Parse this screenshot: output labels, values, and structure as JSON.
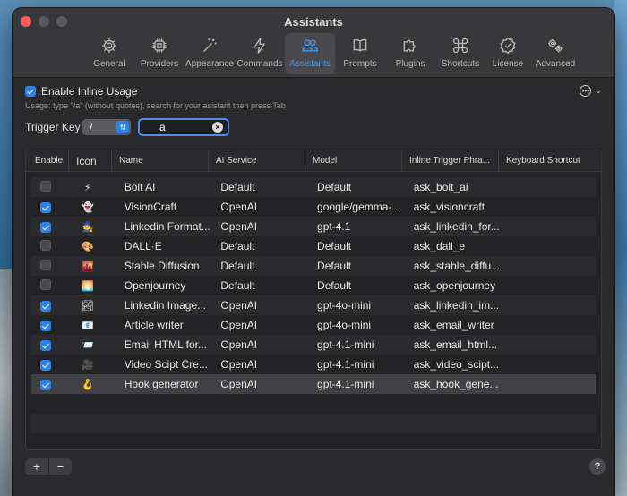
{
  "window": {
    "title": "Assistants"
  },
  "toolbar": {
    "items": [
      {
        "label": "General",
        "icon": "gear-icon"
      },
      {
        "label": "Providers",
        "icon": "chip-icon"
      },
      {
        "label": "Appearance",
        "icon": "magic-wand-icon"
      },
      {
        "label": "Commands",
        "icon": "bolt-icon"
      },
      {
        "label": "Assistants",
        "icon": "people-icon",
        "active": true
      },
      {
        "label": "Prompts",
        "icon": "book-icon"
      },
      {
        "label": "Plugins",
        "icon": "puzzle-icon"
      },
      {
        "label": "Shortcuts",
        "icon": "command-key-icon"
      },
      {
        "label": "License",
        "icon": "badge-check-icon"
      },
      {
        "label": "Advanced",
        "icon": "gears-icon"
      }
    ]
  },
  "inline": {
    "enable_label": "Enable Inline Usage",
    "enabled": true,
    "usage_hint": "Usage: type \"/a\" (without quotes), search for your asistant then press Tab"
  },
  "trigger": {
    "label": "Trigger Key",
    "selected": "/",
    "search_value": "a"
  },
  "table": {
    "columns": [
      "Enable",
      "Icon",
      "Name",
      "AI Service",
      "Model",
      "Inline Trigger Phra...",
      "Keyboard Shortcut"
    ],
    "rows": [
      {
        "enabled": false,
        "icon": "⚡",
        "name": "Bolt AI",
        "service": "Default",
        "model": "Default",
        "trigger": "ask_bolt_ai",
        "shortcut": ""
      },
      {
        "enabled": true,
        "icon": "👻",
        "name": "VisionCraft",
        "service": "OpenAI",
        "model": "google/gemma-...",
        "trigger": "ask_visioncraft",
        "shortcut": ""
      },
      {
        "enabled": true,
        "icon": "🧙",
        "name": "Linkedin Format...",
        "service": "OpenAI",
        "model": "gpt-4.1",
        "trigger": "ask_linkedin_for...",
        "shortcut": ""
      },
      {
        "enabled": false,
        "icon": "🎨",
        "name": "DALL·E",
        "service": "Default",
        "model": "Default",
        "trigger": "ask_dall_e",
        "shortcut": ""
      },
      {
        "enabled": false,
        "icon": "🌇",
        "name": "Stable Diffusion",
        "service": "Default",
        "model": "Default",
        "trigger": "ask_stable_diffu...",
        "shortcut": ""
      },
      {
        "enabled": false,
        "icon": "🌅",
        "name": "Openjourney",
        "service": "Default",
        "model": "Default",
        "trigger": "ask_openjourney",
        "shortcut": ""
      },
      {
        "enabled": true,
        "icon": "🏞",
        "name": "Linkedin Image...",
        "service": "OpenAI",
        "model": "gpt-4o-mini",
        "trigger": "ask_linkedin_im...",
        "shortcut": ""
      },
      {
        "enabled": true,
        "icon": "📧",
        "name": "Article writer",
        "service": "OpenAI",
        "model": "gpt-4o-mini",
        "trigger": "ask_email_writer",
        "shortcut": ""
      },
      {
        "enabled": true,
        "icon": "📨",
        "name": "Email HTML for...",
        "service": "OpenAI",
        "model": "gpt-4.1-mini",
        "trigger": "ask_email_html...",
        "shortcut": ""
      },
      {
        "enabled": true,
        "icon": "🎥",
        "name": "Video Scipt Cre...",
        "service": "OpenAI",
        "model": "gpt-4.1-mini",
        "trigger": "ask_video_scipt...",
        "shortcut": ""
      },
      {
        "enabled": true,
        "icon": "🪝",
        "name": "Hook generator",
        "service": "OpenAI",
        "model": "gpt-4.1-mini",
        "trigger": "ask_hook_gene...",
        "shortcut": "",
        "selected": true
      }
    ]
  },
  "footer": {
    "add_label": "+",
    "remove_label": "−",
    "help_label": "?"
  },
  "colors": {
    "accent": "#2a82ef",
    "active_tab": "#3d9bf5",
    "close": "#ff5f57"
  }
}
